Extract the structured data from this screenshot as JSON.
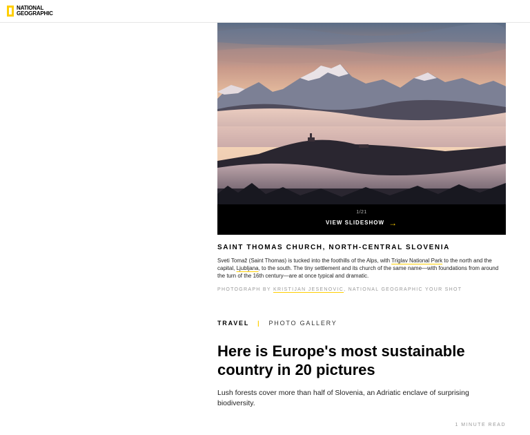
{
  "header": {
    "logo_text": "NATIONAL\nGEOGRAPHIC"
  },
  "hero": {
    "counter": "1/21",
    "view_slideshow": "VIEW SLIDESHOW",
    "arrow_icon": "→"
  },
  "caption": {
    "title": "SAINT THOMAS CHURCH, NORTH-CENTRAL SLOVENIA",
    "body_part1": "Sveti Tomaž (Saint Thomas) is tucked into the foothills of the Alps, with ",
    "link_triglav": "Triglav National Park",
    "body_part2": " to the north and the capital, ",
    "link_ljubljana": "Ljubljana",
    "body_part3": ", to the south. The tiny settlement and its church of the same name—with foundations from around the turn of the 16th century—are at once typical and dramatic.",
    "credit_prefix": "PHOTOGRAPH BY ",
    "credit_name": "KRISTIJAN JESENOVIC",
    "credit_suffix": ", NATIONAL GEOGRAPHIC YOUR SHOT"
  },
  "article": {
    "category": "TRAVEL",
    "separator": "|",
    "subcategory": "PHOTO GALLERY",
    "headline": "Here is Europe's most sustainable country in 20 pictures",
    "dek": "Lush forests cover more than half of Slovenia, an Adriatic enclave of surprising biodiversity.",
    "read_time": "1 MINUTE READ"
  },
  "colors": {
    "brand_yellow": "#FFCE00",
    "bar_black": "#000000"
  }
}
